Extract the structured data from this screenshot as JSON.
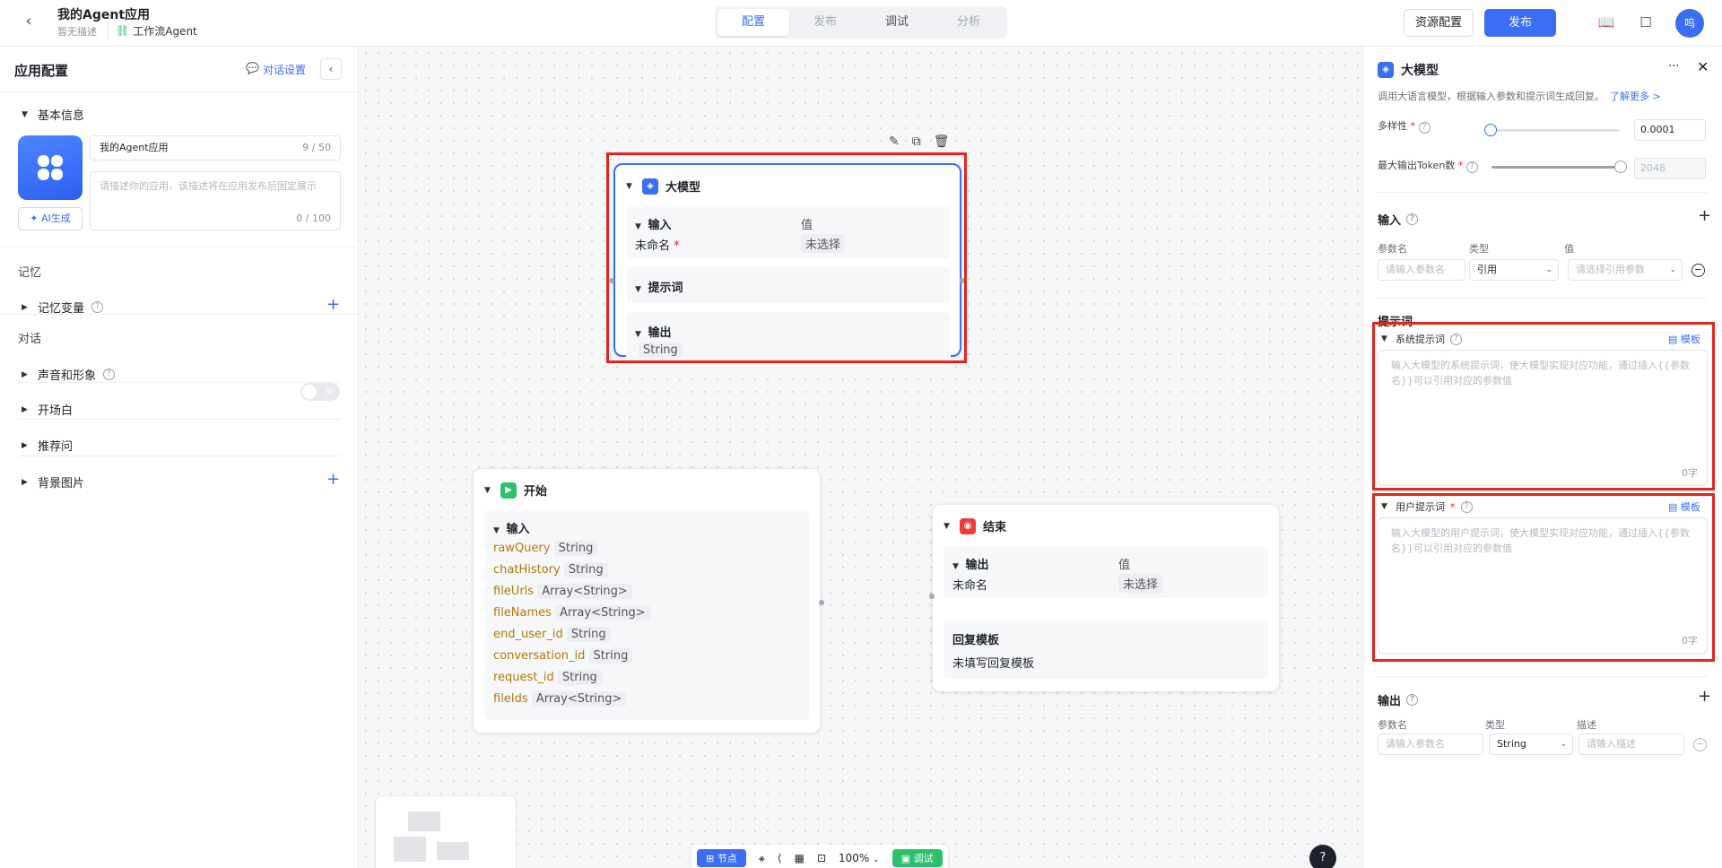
{
  "topbar": {
    "app_name": "我的Agent应用",
    "app_desc": "暂无描述",
    "app_type": "工作流Agent",
    "tabs": [
      "配置",
      "发布",
      "调试",
      "分析"
    ],
    "resource_btn": "资源配置",
    "publish_btn": "发布",
    "avatar_text": "呜"
  },
  "left": {
    "title": "应用配置",
    "dialog_settings": "对话设置",
    "basic_info": "基本信息",
    "name_value": "我的Agent应用",
    "name_count": "9 / 50",
    "desc_placeholder": "请描述你的应用，该描述将在应用发布后固定展示",
    "desc_count": "0 / 100",
    "ai_btn": "AI生成",
    "memory_group": "记忆",
    "memory_vars": "记忆变量",
    "dialog_group": "对话",
    "voice": "声音和形象",
    "toggle_text": "关",
    "opening": "开场白",
    "suggest": "推荐问",
    "bg_image": "背景图片"
  },
  "canvas": {
    "llm_node": {
      "title": "大模型",
      "input_label": "输入",
      "value_col": "值",
      "unnamed": "未命名",
      "unselected": "未选择",
      "prompt_label": "提示词",
      "output_label": "输出",
      "output_type": "String"
    },
    "start_node": {
      "title": "开始",
      "input_label": "输入",
      "vars": [
        {
          "name": "rawQuery",
          "type": "String"
        },
        {
          "name": "chatHistory",
          "type": "String"
        },
        {
          "name": "fileUrls",
          "type": "Array<String>"
        },
        {
          "name": "fileNames",
          "type": "Array<String>"
        },
        {
          "name": "end_user_id",
          "type": "String"
        },
        {
          "name": "conversation_id",
          "type": "String"
        },
        {
          "name": "request_id",
          "type": "String"
        },
        {
          "name": "fileIds",
          "type": "Array<String>"
        }
      ]
    },
    "end_node": {
      "title": "结束",
      "output_label": "输出",
      "value_col": "值",
      "unnamed": "未命名",
      "unselected": "未选择",
      "reply_tpl_label": "回复模板",
      "reply_tpl_value": "未填写回复模板"
    },
    "bottom": {
      "node_btn": "节点",
      "zoom": "100%",
      "debug_btn": "调试"
    }
  },
  "right": {
    "title": "大模型",
    "desc": "调用大语言模型，根据输入参数和提示词生成回复。",
    "learn_more": "了解更多 >",
    "diversity_label": "多样性",
    "diversity_value": "0.0001",
    "max_tokens_label": "最大输出Token数",
    "max_tokens_value": "2048",
    "input_section": "输入",
    "col_param": "参数名",
    "col_type": "类型",
    "col_value": "值",
    "param_placeholder": "请输入参数名",
    "type_value": "引用",
    "value_placeholder": "请选择引用参数",
    "prompt_section": "提示词",
    "system_prompt": "系统提示词",
    "template": "模板",
    "system_placeholder": "输入大模型的系统提示词，使大模型实现对应功能，通过插入{{参数名}}可以引用对应的参数值",
    "char_count": "0字",
    "user_prompt": "用户提示词",
    "user_placeholder": "输入大模型的用户提示词，使大模型实现对应功能，通过插入{{参数名}}可以引用对应的参数值",
    "output_section": "输出",
    "col_desc": "描述",
    "out_type_value": "String",
    "desc_placeholder": "请输入描述"
  },
  "colors": {
    "accent": "#3b6df5",
    "highlight": "#e8231d",
    "start_green": "#2ac16a",
    "end_red": "#f03a3a"
  }
}
